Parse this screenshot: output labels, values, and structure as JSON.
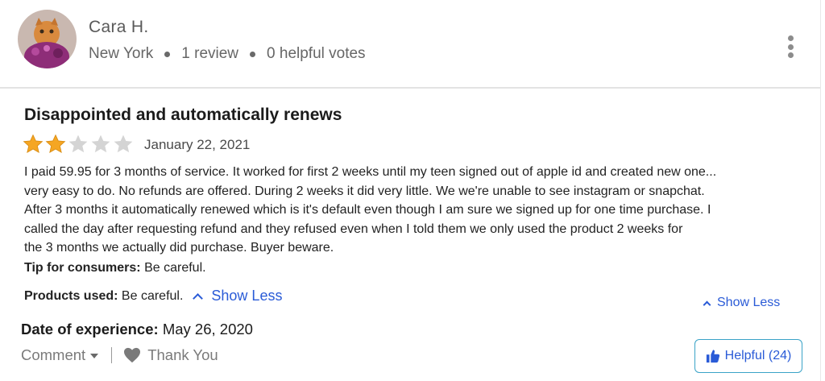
{
  "reviewer": {
    "name": "Cara H.",
    "location": "New York",
    "reviews": "1 review",
    "helpful_votes": "0 helpful votes"
  },
  "review": {
    "title": "Disappointed and automatically renews",
    "rating": 2,
    "max_rating": 5,
    "date": "January 22, 2021",
    "body": "I paid 59.95 for 3 months of service. It worked for first 2 weeks until my teen signed out of apple id and created new one...\nvery easy to do. No refunds are offered. During 2 weeks it did very little. We we're unable to see instagram or snapchat.\nAfter 3 months it automatically renewed which is it's default even though I am sure we signed up for one time purchase. I\ncalled the day after requesting refund and they refused even when I told them we only used the product 2 weeks for\nthe 3 months we actually did purchase. Buyer beware.",
    "tip_label": "Tip for consumers:",
    "tip_value": "Be careful.",
    "products_label": "Products used:",
    "products_value": "Be careful.",
    "show_less_inline": "Show Less",
    "show_less_right": "Show Less",
    "experience_label": "Date of experience:",
    "experience_value": "May 26, 2020"
  },
  "actions": {
    "comment": "Comment",
    "thank_you": "Thank You",
    "helpful": "Helpful (24)"
  },
  "colors": {
    "star_filled": "#f5a623",
    "star_empty": "#d4d4d4",
    "link": "#2a5bd7",
    "helpful_border": "#3aa3c7"
  },
  "icons": [
    "more-vertical-icon",
    "star-icon",
    "chevron-up-icon",
    "caret-down-icon",
    "heart-icon",
    "thumbs-up-icon"
  ]
}
